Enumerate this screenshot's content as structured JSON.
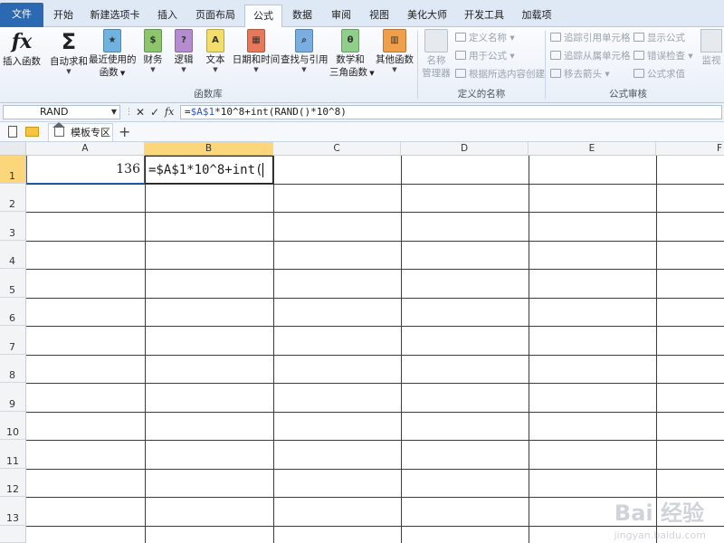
{
  "tabs": [
    {
      "label": "文件",
      "key": "file"
    },
    {
      "label": "开始",
      "key": "home"
    },
    {
      "label": "新建选项卡",
      "key": "newtab"
    },
    {
      "label": "插入",
      "key": "insert"
    },
    {
      "label": "页面布局",
      "key": "layout"
    },
    {
      "label": "公式",
      "key": "formulas"
    },
    {
      "label": "数据",
      "key": "data"
    },
    {
      "label": "审阅",
      "key": "review"
    },
    {
      "label": "视图",
      "key": "view"
    },
    {
      "label": "美化大师",
      "key": "beautify"
    },
    {
      "label": "开发工具",
      "key": "dev"
    },
    {
      "label": "加载项",
      "key": "addins"
    }
  ],
  "active_tab": "公式",
  "ribbon": {
    "insert_function": "插入函数",
    "autosum": "自动求和",
    "recent_1": "最近使用的",
    "recent_2": "函数",
    "financial": "财务",
    "logical": "逻辑",
    "text": "文本",
    "datetime": "日期和时间",
    "lookup": "查找与引用",
    "math_1": "数学和",
    "math_2": "三角函数",
    "more": "其他函数",
    "group_library": "函数库",
    "name_mgr_1": "名称",
    "name_mgr_2": "管理器",
    "define_name": "定义名称",
    "use_in_formula": "用于公式",
    "create_from_sel": "根据所选内容创建",
    "group_names": "定义的名称",
    "trace_precedents": "追踪引用单元格",
    "trace_dependents": "追踪从属单元格",
    "remove_arrows": "移去箭头",
    "show_formulas": "显示公式",
    "error_checking": "错误检查",
    "evaluate_formula": "公式求值",
    "watch": "监视",
    "group_auditing": "公式审核"
  },
  "formula_bar": {
    "name_box": "RAND",
    "fx": "fx",
    "f_prefix": "=",
    "f_ref": "$A$1",
    "f_rest": "*10^8+int(RAND()*10^8)"
  },
  "sheet_bar": {
    "template_tab": "模板专区",
    "add": "+"
  },
  "columns": [
    "A",
    "B",
    "C",
    "D",
    "E",
    "F"
  ],
  "rows": [
    "1",
    "2",
    "3",
    "4",
    "5",
    "6",
    "7",
    "8",
    "9",
    "10",
    "11",
    "12",
    "13"
  ],
  "cells": {
    "A1": "136",
    "B1": "=$A$1*10^8+int("
  },
  "watermark": {
    "line1": "Bai 经验",
    "line2": "jingyan.baidu.com"
  },
  "colors": {
    "file_tab": "#2c69b3",
    "selection": "#fbd67b",
    "ref_blue": "#2b56c6"
  }
}
